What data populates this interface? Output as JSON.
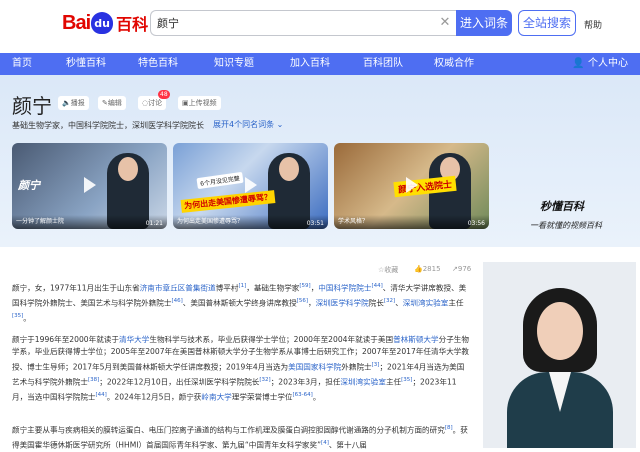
{
  "header": {
    "logo_bai": "Bai",
    "logo_du": "du",
    "logo_baike": "百科",
    "search_value": "颜宁",
    "enter_button": "进入词条",
    "search_button": "全站搜索",
    "help": "帮助"
  },
  "nav": {
    "items": [
      "首页",
      "秒懂百科",
      "特色百科",
      "知识专题",
      "加入百科",
      "百科团队",
      "权威合作"
    ],
    "user": "个人中心"
  },
  "entry": {
    "title": "颜宁",
    "tools": {
      "play": "播报",
      "edit": "编辑",
      "discuss": "讨论",
      "discuss_count": "48",
      "upload": "上传视频"
    },
    "subtitle": "基础生物学家，中国科学院院士，深圳医学科学院院长",
    "expand": "展开4个同名词条"
  },
  "videos": [
    {
      "caption": "一分钟了解颜士院",
      "duration": "01:21",
      "name": "颜宁",
      "sub": "深圳医学科学院院长"
    },
    {
      "caption": "为何出走美国惨遭辱骂？",
      "duration": "03:51",
      "name": "颜宁",
      "banner": "为何出走美国惨遭辱骂？",
      "sub": "6个月没见完整"
    },
    {
      "caption": "学术风格？",
      "duration": "03:56",
      "tag": "颜宁入选院士"
    }
  ],
  "brand": {
    "top": "秒懂百科",
    "bottom": "一看就懂的视频百科"
  },
  "meta": {
    "favorite": "收藏",
    "likes": "2815",
    "shares": "976"
  },
  "paragraphs": {
    "p1": {
      "a": "颜宁，女，1977年11月出生于山东省",
      "link1": "济南市章丘区普集街道",
      "b": "博平村",
      "r1": "[1]",
      "c": "，基础生物学家",
      "r2": "[59]",
      "d": "，",
      "link2": "中国科学院院士",
      "r3": "[44]",
      "e": "、清华大学讲席教授、美国科学院外籍院士、美国艺术与科学院外籍院士",
      "r4": "[46]",
      "f": "、美国普林斯顿大学终身讲席教授",
      "r5": "[56]",
      "g": "，",
      "link3": "深圳医学科学院",
      "h": "院长",
      "r6": "[32]",
      "i": "、",
      "link4": "深圳湾实验室",
      "j": "主任",
      "r7": "[35]",
      "k": "。"
    },
    "p2": {
      "a": "颜宁于1996年至2000年就读于",
      "link1": "清华大学",
      "b": "生物科学与技术系，毕业后获得学士学位；2000年至2004年就读于美国",
      "link2": "普林斯顿大学",
      "c": "分子生物学系，毕业后获得博士学位；2005年至2007年在美国普林斯顿大学分子生物学系从事博士后研究工作；2007年至2017年任清华大学教授、博士生导师；2017年5月到美国普林斯顿大学任讲席教授；2019年4月当选为",
      "link3": "美国国家科学院",
      "d": "外籍院士",
      "r1": "[3]",
      "e": "；2021年4月当选为美国艺术与科学院外籍院士",
      "r2": "[38]",
      "f": "；2022年12月10日，出任深圳医学科学院院长",
      "r3": "[32]",
      "g": "；2023年3月，担任",
      "link4": "深圳湾实验室",
      "h": "主任",
      "r4": "[35]",
      "i": "；2023年11月，当选中国科学院院士",
      "r5": "[44]",
      "j": "。2024年12月5日，颜宁获",
      "link5": "岭南大学",
      "k": "理学荣誉博士学位",
      "r6": "[63-64]",
      "l": "。"
    },
    "p3": {
      "a": "颜宁主要从事与疾病相关的膜转运蛋白、电压门控离子通道的结构与工作机理及膜蛋白调控胆固醇代谢通路的分子机制方面的研究",
      "r1": "[8]",
      "b": "。获得美国霍华德休斯医学研究所（HHMI）首届国际青年科学家、第九届“中国青年女科学家奖”",
      "r2": "[4]",
      "c": "、第十八届"
    }
  }
}
